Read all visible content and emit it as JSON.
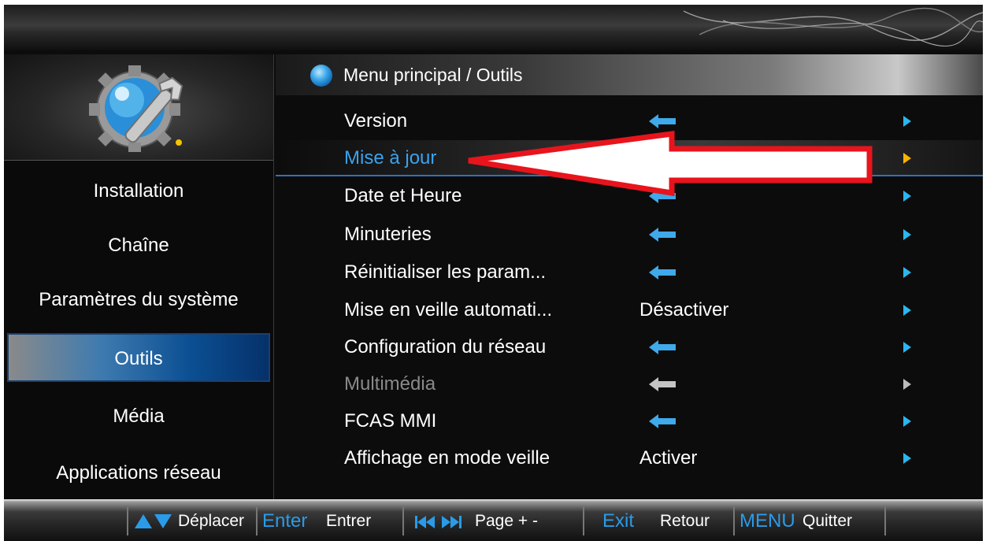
{
  "header": {
    "title": "Menu principal / Outils"
  },
  "sidebar": {
    "items": [
      {
        "label": "Installation"
      },
      {
        "label": "Chaîne"
      },
      {
        "label": "Paramètres du système"
      },
      {
        "label": "Outils",
        "active": true
      },
      {
        "label": "Média"
      },
      {
        "label": "Applications réseau"
      }
    ]
  },
  "menu": {
    "items": [
      {
        "label": "Version",
        "value": "",
        "state": "normal"
      },
      {
        "label": "Mise à jour",
        "value": "",
        "state": "selected"
      },
      {
        "label": "Date et Heure",
        "value": "",
        "state": "normal"
      },
      {
        "label": "Minuteries",
        "value": "",
        "state": "normal"
      },
      {
        "label": "Réinitialiser les param...",
        "value": "",
        "state": "normal"
      },
      {
        "label": "Mise en veille automati...",
        "value": "Désactiver",
        "state": "normal"
      },
      {
        "label": "Configuration du réseau",
        "value": "",
        "state": "normal"
      },
      {
        "label": "Multimédia",
        "value": "",
        "state": "disabled"
      },
      {
        "label": "FCAS MMI",
        "value": "",
        "state": "normal"
      },
      {
        "label": "Affichage en mode veille",
        "value": "Activer",
        "state": "normal"
      }
    ]
  },
  "footer": {
    "move_label": "Déplacer",
    "enter_key": "Enter",
    "enter_label": "Entrer",
    "page_label": "Page + -",
    "exit_key": "Exit",
    "exit_label": "Retour",
    "menu_key": "MENU",
    "menu_label": "Quitter"
  },
  "icons": {
    "logo": "tools-gear-wrench-icon",
    "header": "blue-orb-icon",
    "enter_submenu": "left-arrow-icon",
    "row_pointer": "right-triangle-icon",
    "nav": "up-down-triangle-icon",
    "page": "skip-back-forward-icon"
  },
  "colors": {
    "accent_blue": "#2a9be8",
    "selected_label": "#3aa3ee",
    "selected_pointer": "#f5b400",
    "callout_red": "#e8141c"
  }
}
